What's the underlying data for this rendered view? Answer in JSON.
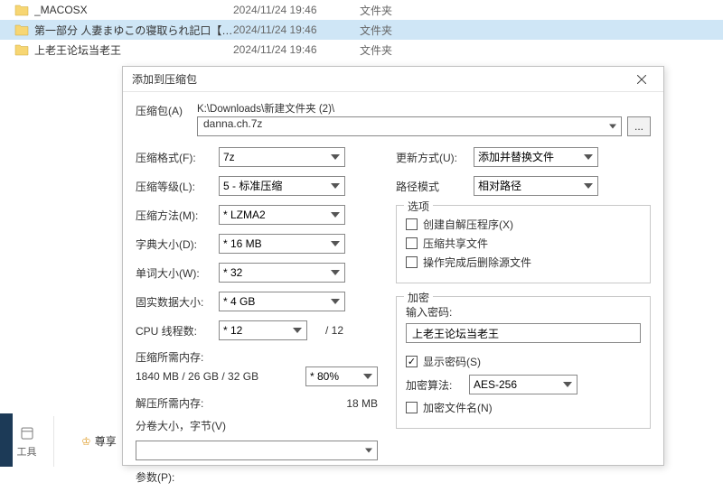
{
  "file_list": [
    {
      "name": "_MACOSX",
      "date": "2024/11/24 19:46",
      "type": "文件夹",
      "selected": false
    },
    {
      "name": "第一部分 人妻まゆこの寝取られ記口【ガ...",
      "date": "2024/11/24 19:46",
      "type": "文件夹",
      "selected": true
    },
    {
      "name": "上老王论坛当老王",
      "date": "2024/11/24 19:46",
      "type": "文件夹",
      "selected": false
    }
  ],
  "dialog": {
    "title": "添加到压缩包",
    "archive_label": "压缩包(A)",
    "archive_path": "K:\\Downloads\\新建文件夹 (2)\\",
    "archive_name": "danna.ch.7z",
    "browse_ellipsis": "...",
    "left": {
      "format_label": "压缩格式(F):",
      "format_value": "7z",
      "level_label": "压缩等级(L):",
      "level_value": "5 - 标准压缩",
      "method_label": "压缩方法(M):",
      "method_value": "* LZMA2",
      "dict_label": "字典大小(D):",
      "dict_value": "* 16 MB",
      "word_label": "单词大小(W):",
      "word_value": "* 32",
      "solid_label": "固实数据大小:",
      "solid_value": "* 4 GB",
      "cpu_label": "CPU 线程数:",
      "cpu_value": "* 12",
      "cpu_total": "/ 12",
      "compress_mem_label": "压缩所需内存:",
      "compress_mem_value": "1840 MB / 26 GB / 32 GB",
      "compress_pct": "* 80%",
      "decompress_mem_label": "解压所需内存:",
      "decompress_mem_value": "18 MB",
      "split_label": "分卷大小，字节(V)",
      "split_value": "",
      "params_label": "参数(P):"
    },
    "right": {
      "update_label": "更新方式(U):",
      "update_value": "添加并替换文件",
      "path_label": "路径模式",
      "path_value": "相对路径",
      "options_group": "选项",
      "opt_sfx": "创建自解压程序(X)",
      "opt_shared": "压缩共享文件",
      "opt_delete": "操作完成后删除源文件",
      "encrypt_group": "加密",
      "pw_label": "输入密码:",
      "pw_value": "上老王论坛当老王",
      "show_pw": "显示密码(S)",
      "algo_label": "加密算法:",
      "algo_value": "AES-256",
      "encrypt_names": "加密文件名(N)"
    }
  },
  "sidebar": {
    "tool_label": "工具",
    "bottom_text": "尊享"
  }
}
